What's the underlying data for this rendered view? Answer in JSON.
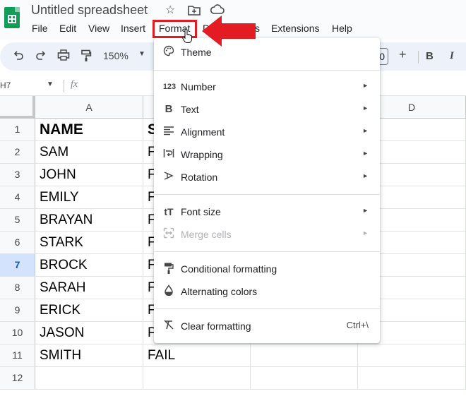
{
  "app": {
    "doc_title": "Untitled spreadsheet",
    "icons": [
      "star-icon",
      "move-to-folder-icon",
      "cloud-status-icon"
    ]
  },
  "menubar": {
    "items": [
      {
        "label": "File"
      },
      {
        "label": "Edit"
      },
      {
        "label": "View"
      },
      {
        "label": "Insert"
      },
      {
        "label": "Format"
      },
      {
        "label": "Data"
      },
      {
        "label": "Tools"
      },
      {
        "label": "Extensions"
      },
      {
        "label": "Help"
      }
    ],
    "visible_fragments": {
      "data_fragment": "D",
      "tools_fragment": "s"
    }
  },
  "toolbar": {
    "zoom": "150%",
    "font_size": "10",
    "plus": "+",
    "bold": "B",
    "italic": "I"
  },
  "formula_bar": {
    "name_box": "H7",
    "fx": "fx"
  },
  "sheet": {
    "columns": [
      "A",
      "D"
    ],
    "rows": [
      {
        "n": "1",
        "a": "NAME",
        "b": "S"
      },
      {
        "n": "2",
        "a": "SAM",
        "b": "F"
      },
      {
        "n": "3",
        "a": "JOHN",
        "b": "F"
      },
      {
        "n": "4",
        "a": "EMILY",
        "b": "F"
      },
      {
        "n": "5",
        "a": "BRAYAN",
        "b": "F"
      },
      {
        "n": "6",
        "a": "STARK",
        "b": "F"
      },
      {
        "n": "7",
        "a": "BROCK",
        "b": "F"
      },
      {
        "n": "8",
        "a": "SARAH",
        "b": "F"
      },
      {
        "n": "9",
        "a": "ERICK",
        "b": "F"
      },
      {
        "n": "10",
        "a": "JASON",
        "b": "PASS"
      },
      {
        "n": "11",
        "a": "SMITH",
        "b": "FAIL"
      },
      {
        "n": "12",
        "a": "",
        "b": ""
      }
    ],
    "active_row": "7"
  },
  "format_menu": {
    "items": [
      {
        "label": "Theme",
        "icon": "palette-icon"
      },
      {
        "label": "Number",
        "icon": "number-format-icon",
        "glyph": "123"
      },
      {
        "label": "Text",
        "icon": "bold-text-icon",
        "glyph": "B"
      },
      {
        "label": "Alignment",
        "icon": "align-left-icon"
      },
      {
        "label": "Wrapping",
        "icon": "text-wrap-icon"
      },
      {
        "label": "Rotation",
        "icon": "text-rotation-icon"
      },
      {
        "label": "Font size",
        "icon": "font-size-icon",
        "glyph": "tT"
      },
      {
        "label": "Merge cells",
        "icon": "merge-cells-icon",
        "disabled": true
      },
      {
        "label": "Conditional formatting",
        "icon": "paint-roller-icon"
      },
      {
        "label": "Alternating colors",
        "icon": "drop-fill-icon"
      },
      {
        "label": "Clear formatting",
        "icon": "clear-formatting-icon",
        "shortcut": "Ctrl+\\"
      }
    ],
    "submenu_arrow": "►"
  },
  "colors": {
    "highlight_red": "#e31b23",
    "accent_blue": "#0b57d0",
    "sheets_green": "#0f9d58"
  }
}
